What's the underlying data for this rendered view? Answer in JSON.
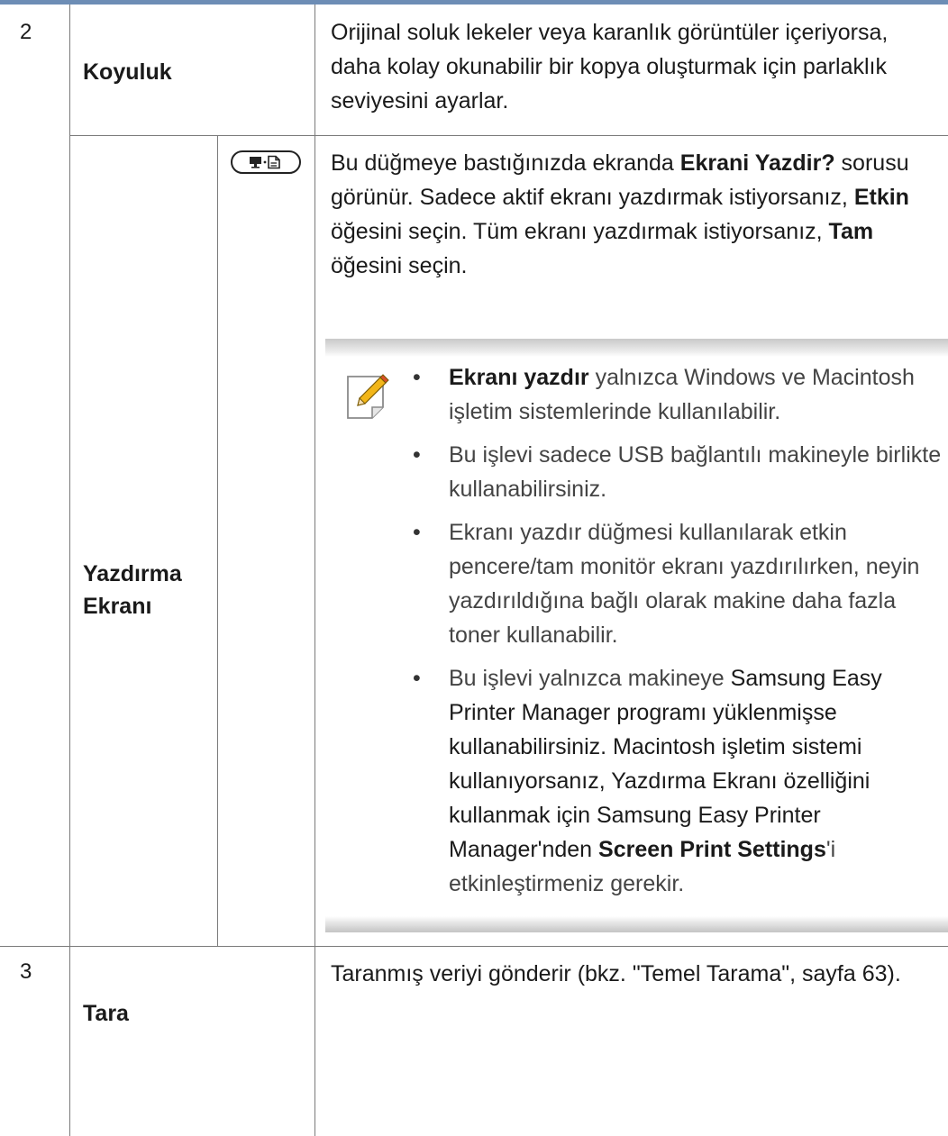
{
  "rows": [
    {
      "number": "2",
      "label": "Koyuluk",
      "description": "Orijinal soluk lekeler veya karanlık görüntüler içeriyorsa, daha kolay okunabilir bir kopya oluşturmak için parlaklık seviyesini ayarlar."
    },
    {
      "label_line1": "Yazdırma",
      "label_line2": "Ekranı",
      "button_icon": "print-screen-button-icon",
      "desc": {
        "p1": "Bu düğmeye bastığınızda ekranda ",
        "b1": "Ekrani Yazdir?",
        "p2": " sorusu görünür. Sadece aktif ekranı yazdırmak istiyorsanız, ",
        "b2": "Etkin",
        "p3": " öğesini seçin. Tüm ekranı yazdırmak istiyorsanız, ",
        "b3": "Tam",
        "p4": " öğesini seçin."
      },
      "note": {
        "icon": "note-pencil-icon",
        "bullet_glyph": "•",
        "items": [
          {
            "bold": "Ekranı yazdır",
            "text": " yalnızca Windows ve Macintosh işletim sistemlerinde kullanılabilir."
          },
          {
            "text": "Bu işlevi sadece USB bağlantılı makineyle birlikte kullanabilirsiniz."
          },
          {
            "text": "Ekranı yazdır düğmesi kullanılarak etkin pencere/tam monitör ekranı yazdırılırken, neyin yazdırıldığına bağlı olarak makine daha fazla toner kullanabilir."
          },
          {
            "t1": "Bu işlevi yalnızca makineye ",
            "t2": "Samsung Easy Printer Manager",
            "t3": " programı yüklenmişse kullanabilirsiniz. Macintosh işletim sistemi kullanıyorsanız, Yazdırma Ekranı özelliğini kullanmak için Samsung Easy Printer Manager'nden ",
            "b1": "Screen Print Settings",
            "t4": "'i etkinleştirmeniz gerekir."
          }
        ]
      }
    },
    {
      "number": "3",
      "label": "Tara",
      "description": "Taranmış veriyi gönderir (bkz. \"Temel Tarama\", sayfa 63)."
    }
  ]
}
